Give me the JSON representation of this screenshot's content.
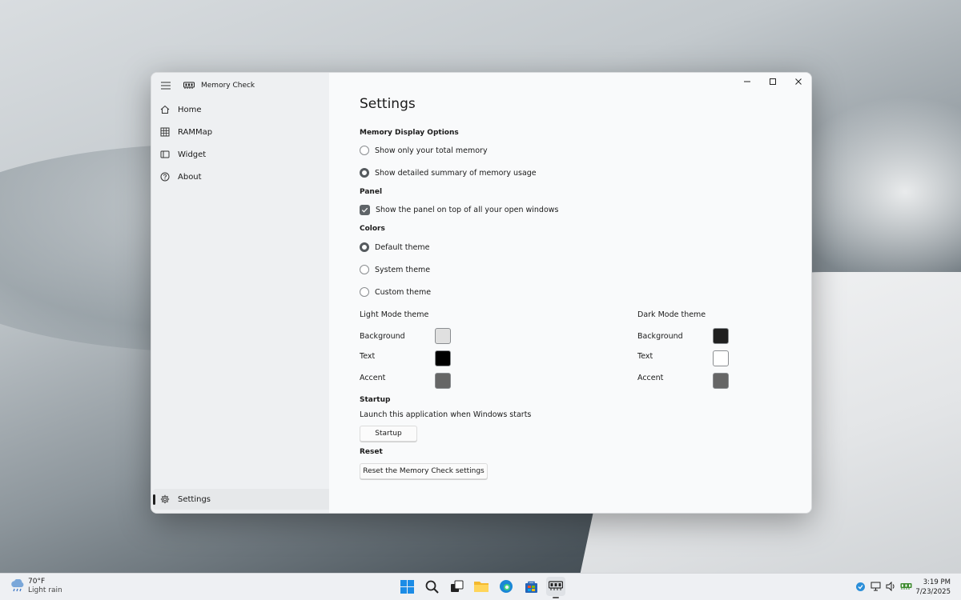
{
  "app": {
    "title": "Memory Check"
  },
  "sidebar": {
    "items": [
      {
        "label": "Home",
        "icon": "home-icon"
      },
      {
        "label": "RAMMap",
        "icon": "grid-icon"
      },
      {
        "label": "Widget",
        "icon": "widget-icon"
      },
      {
        "label": "About",
        "icon": "help-icon"
      }
    ],
    "settings_label": "Settings"
  },
  "settings": {
    "title": "Settings",
    "memory_display": {
      "heading": "Memory Display Options",
      "options": [
        {
          "label": "Show only your total memory",
          "selected": false
        },
        {
          "label": "Show detailed summary of memory usage",
          "selected": true
        }
      ]
    },
    "panel": {
      "heading": "Panel",
      "checkbox_label": "Show the panel on top of all your open windows",
      "checked": true
    },
    "colors": {
      "heading": "Colors",
      "options": [
        {
          "label": "Default theme",
          "selected": true
        },
        {
          "label": "System theme",
          "selected": false
        },
        {
          "label": "Custom theme",
          "selected": false
        }
      ],
      "light": {
        "heading": "Light Mode theme",
        "background_label": "Background",
        "background": "#e0e0e0",
        "text_label": "Text",
        "text": "#000000",
        "accent_label": "Accent",
        "accent": "#666666"
      },
      "dark": {
        "heading": "Dark Mode theme",
        "background_label": "Background",
        "background": "#202020",
        "text_label": "Text",
        "text": "#ffffff",
        "accent_label": "Accent",
        "accent": "#666666"
      }
    },
    "startup": {
      "heading": "Startup",
      "description": "Launch this application when Windows starts",
      "button_label": "Startup"
    },
    "reset": {
      "heading": "Reset",
      "button_label": "Reset the Memory Check settings"
    }
  },
  "taskbar": {
    "weather": {
      "temp": "70°F",
      "condition": "Light rain"
    },
    "clock": {
      "time": "3:19 PM",
      "date": "7/23/2025"
    }
  }
}
